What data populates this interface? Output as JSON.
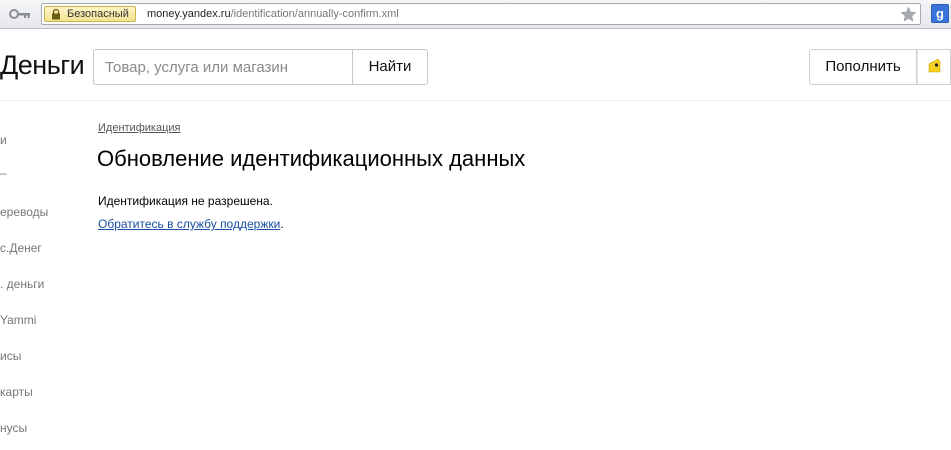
{
  "browser": {
    "security_label": "Безопасный",
    "url_host": "money.yandex.ru",
    "url_path": "/identification/annually-confirm.xml",
    "extension_letter": "g"
  },
  "header": {
    "logo": "Деньги",
    "search_placeholder": "Товар, услуга или магазин",
    "search_button": "Найти",
    "topup_button": "Пополнить"
  },
  "sidebar": {
    "items": [
      {
        "label": "и"
      },
      {
        "label": "–"
      },
      {
        "label": "ереводы"
      },
      {
        "label": "с.Денег"
      },
      {
        "label": ". деньги"
      },
      {
        "label": "Yammi"
      },
      {
        "label": "исы"
      },
      {
        "label": "карты"
      },
      {
        "label": "нусы"
      }
    ]
  },
  "main": {
    "breadcrumb": "Идентификация",
    "title": "Обновление идентификационных данных",
    "message": "Идентификация не разрешена.",
    "support_link": "Обратитесь в службу поддержки",
    "support_suffix": "."
  }
}
